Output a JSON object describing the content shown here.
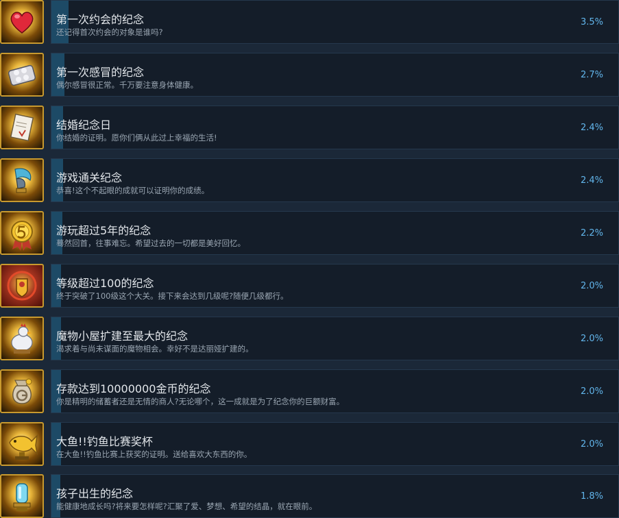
{
  "achievements": [
    {
      "title": "第一次约会的纪念",
      "desc": "还记得首次约会的对象是谁吗?",
      "percent": "3.5%",
      "fill": 0.035,
      "icon": "heart-icon"
    },
    {
      "title": "第一次感冒的纪念",
      "desc": "偶尔感冒很正常。千万要注意身体健康。",
      "percent": "2.7%",
      "fill": 0.027,
      "icon": "pill-pack-icon"
    },
    {
      "title": "结婚纪念日",
      "desc": "你结婚的证明。愿你们俩从此过上幸福的生活!",
      "percent": "2.4%",
      "fill": 0.024,
      "icon": "certificate-icon"
    },
    {
      "title": "游戏通关纪念",
      "desc": "恭喜!这个不起眼的成就可以证明你的成绩。",
      "percent": "2.4%",
      "fill": 0.024,
      "icon": "trophy-wing-icon"
    },
    {
      "title": "游玩超过5年的纪念",
      "desc": "蓦然回首，往事难忘。希望过去的一切都是美好回忆。",
      "percent": "2.2%",
      "fill": 0.022,
      "icon": "medal-5-icon"
    },
    {
      "title": "等级超过100的纪念",
      "desc": "终于突破了100级这个大关。接下来会达到几级呢?随便几级都行。",
      "percent": "2.0%",
      "fill": 0.02,
      "icon": "crest-icon"
    },
    {
      "title": "魔物小屋扩建至最大的纪念",
      "desc": "渴求着与尚未谋面的魔物相会。幸好不是达丽娅扩建的。",
      "percent": "2.0%",
      "fill": 0.02,
      "icon": "chicken-icon"
    },
    {
      "title": "存款达到10000000金币的纪念",
      "desc": "你是精明的储蓄者还是无情的商人?无论哪个，这一成就是为了纪念你的巨额财富。",
      "percent": "2.0%",
      "fill": 0.02,
      "icon": "money-bag-icon"
    },
    {
      "title": "大鱼!!钓鱼比赛奖杯",
      "desc": "在大鱼!!钓鱼比赛上获奖的证明。送给喜欢大东西的你。",
      "percent": "2.0%",
      "fill": 0.02,
      "icon": "fish-trophy-icon"
    },
    {
      "title": "孩子出生的纪念",
      "desc": "能健康地成长吗?将来要怎样呢?汇聚了爱、梦想、希望的结晶，就在眼前。",
      "percent": "1.8%",
      "fill": 0.018,
      "icon": "crystal-icon"
    }
  ]
}
